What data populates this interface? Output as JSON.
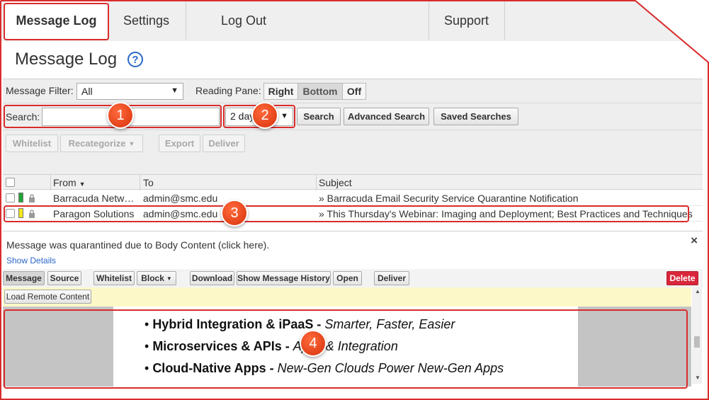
{
  "nav": {
    "tabs": [
      {
        "label": "Message Log",
        "active": true
      },
      {
        "label": "Settings"
      },
      {
        "label": "Log Out"
      },
      {
        "label": "Support"
      }
    ]
  },
  "page": {
    "title": "Message Log",
    "help_icon": "?"
  },
  "filter": {
    "label": "Message Filter:",
    "value": "All",
    "reading_pane_label": "Reading Pane:",
    "reading_pane_options": [
      "Right",
      "Bottom",
      "Off"
    ],
    "reading_pane_selected": "Bottom"
  },
  "search": {
    "label": "Search:",
    "value": "",
    "range_value": "2 days",
    "search_button": "Search",
    "advanced_button": "Advanced Search",
    "saved_button": "Saved Searches"
  },
  "actions": {
    "whitelist": "Whitelist",
    "recategorize": "Recategorize",
    "export": "Export",
    "deliver": "Deliver"
  },
  "table": {
    "columns": [
      "From",
      "To",
      "Subject"
    ],
    "rows": [
      {
        "from": "Barracuda Netw…",
        "to": "admin@smc.edu",
        "subject": "» Barracuda Email Security Service Quarantine Notification",
        "flag_color": "#22a33a"
      },
      {
        "from": "Paragon Solutions",
        "to": "admin@smc.edu",
        "subject": "» This Thursday's Webinar: Imaging and Deployment; Best Practices and Techniques",
        "flag_color": "#f2e81b"
      }
    ]
  },
  "preview": {
    "notice": "Message was quarantined due to Body Content (click here).",
    "show_details": "Show Details",
    "close_glyph": "×",
    "toolbar": {
      "message": "Message",
      "source": "Source",
      "whitelist": "Whitelist",
      "block": "Block",
      "download": "Download",
      "history": "Show Message History",
      "open": "Open",
      "deliver": "Deliver",
      "delete": "Delete"
    },
    "load_remote": "Load Remote Content",
    "bullets": [
      {
        "bold": "Hybrid Integration & iPaaS - ",
        "italic": "Smarter, Faster, Easier"
      },
      {
        "bold": "Microservices & APIs - ",
        "italic": "Apps & Integration"
      },
      {
        "bold": "Cloud-Native Apps - ",
        "italic": "New-Gen Clouds Power New-Gen Apps"
      }
    ]
  },
  "markers": [
    "1",
    "2",
    "3",
    "4"
  ],
  "colors": {
    "annotation": "#d92b2b",
    "delete": "#d9263a",
    "link": "#2a67c9"
  }
}
